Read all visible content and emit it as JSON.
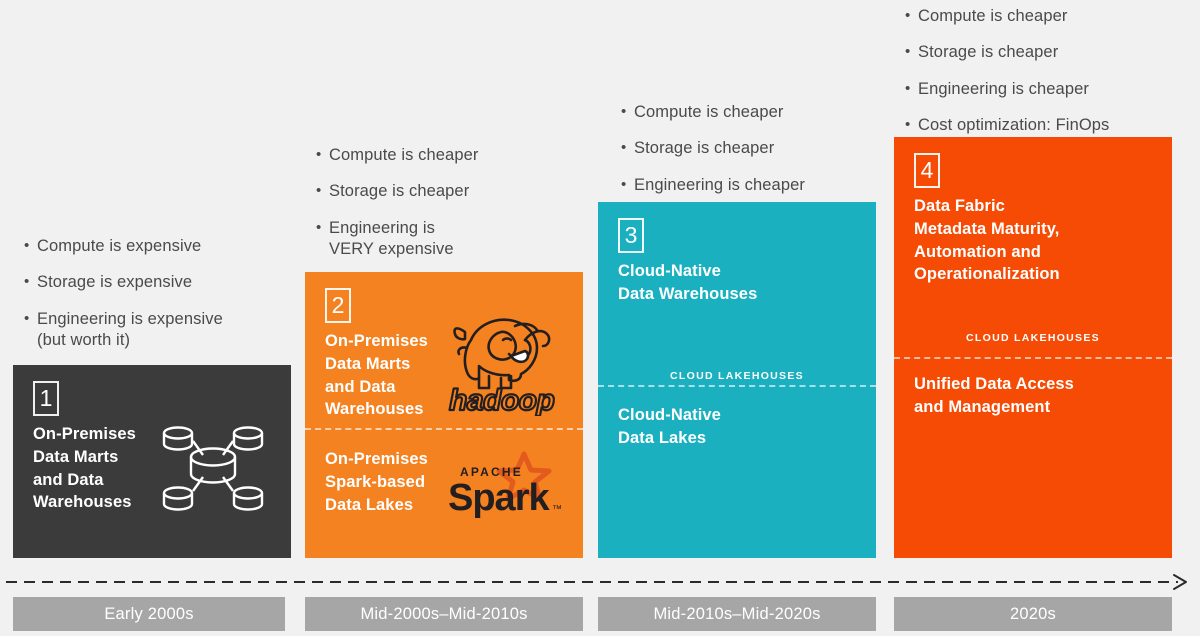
{
  "theme": {
    "background": "#f1f1f1",
    "panel_1_color": "#3b3b3b",
    "panel_2_color": "#f58220",
    "panel_3_color": "#1ab0c0",
    "panel_4_color": "#f54b05",
    "era_bar_color": "#a6a6a6",
    "bullet_text_color": "#4a4a4a"
  },
  "columns": [
    {
      "number": "1",
      "bullets": [
        {
          "text": "Compute is expensive",
          "second_line": ""
        },
        {
          "text": "Storage is expensive",
          "second_line": ""
        },
        {
          "text": "Engineering is expensive",
          "second_line": "(but worth it)"
        }
      ],
      "panel": {
        "title": "On-Premises\nData Marts\nand Data\nWarehouses",
        "icon": "database-hub-icon",
        "divider_label": "",
        "sub_title": ""
      },
      "era": "Early 2000s"
    },
    {
      "number": "2",
      "bullets": [
        {
          "text": "Compute is cheaper",
          "second_line": ""
        },
        {
          "text": "Storage is cheaper",
          "second_line": ""
        },
        {
          "text": "Engineering is",
          "second_line": "VERY expensive"
        }
      ],
      "panel": {
        "title": "On-Premises\nData Marts\nand Data\nWarehouses",
        "icon": "hadoop-logo-icon",
        "divider_label": "",
        "sub_title": "On-Premises\nSpark-based\nData Lakes",
        "sub_icon": "apache-spark-logo-icon"
      },
      "era": "Mid-2000s–Mid-2010s"
    },
    {
      "number": "3",
      "bullets": [
        {
          "text": "Compute is cheaper",
          "second_line": ""
        },
        {
          "text": "Storage is cheaper",
          "second_line": ""
        },
        {
          "text": "Engineering is cheaper",
          "second_line": ""
        }
      ],
      "panel": {
        "title": "Cloud-Native\nData Warehouses",
        "icon": "",
        "divider_label": "CLOUD LAKEHOUSES",
        "sub_title": "Cloud-Native\nData Lakes"
      },
      "era": "Mid-2010s–Mid-2020s"
    },
    {
      "number": "4",
      "bullets": [
        {
          "text": "Compute is cheaper",
          "second_line": ""
        },
        {
          "text": "Storage is cheaper",
          "second_line": ""
        },
        {
          "text": "Engineering is cheaper",
          "second_line": ""
        },
        {
          "text": "Cost optimization: FinOps",
          "second_line": ""
        }
      ],
      "panel": {
        "title": "Data Fabric\nMetadata Maturity,\nAutomation and\nOperationalization",
        "icon": "",
        "divider_label": "CLOUD LAKEHOUSES",
        "sub_title": "Unified Data Access\nand Management"
      },
      "era": "2020s"
    }
  ],
  "timeline": {
    "arrow_icon": "dashed-arrow-right-icon",
    "bullet_glyph": "•"
  }
}
